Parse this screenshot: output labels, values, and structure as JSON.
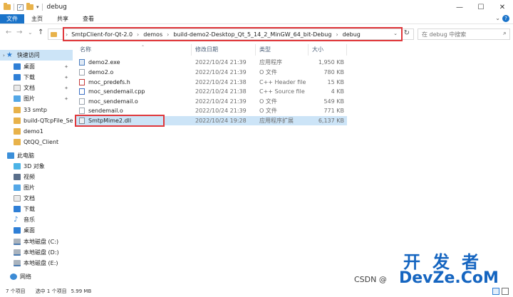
{
  "window": {
    "title": "debug",
    "minimize": "—",
    "maximize": "☐",
    "close": "✕"
  },
  "ribbon": {
    "tabs": [
      {
        "label": "文件"
      },
      {
        "label": "主页"
      },
      {
        "label": "共享"
      },
      {
        "label": "查看"
      }
    ],
    "expand": "⌄",
    "help": "?"
  },
  "nav": {
    "back": "←",
    "forward": "→",
    "recent": "⌄",
    "up": "↑"
  },
  "address": {
    "crumbs": [
      "SmtpClient-for-Qt-2.0",
      "demos",
      "build-demo2-Desktop_Qt_5_14_2_MinGW_64_bit-Debug",
      "debug"
    ],
    "separator": "›",
    "dropdown": "⌄",
    "refresh": "↻"
  },
  "search": {
    "placeholder": "在 debug 中搜索"
  },
  "sidebar": {
    "quick_access": "快速访问",
    "items": [
      {
        "label": "桌面",
        "pinned": true
      },
      {
        "label": "下载",
        "pinned": true
      },
      {
        "label": "文档",
        "pinned": true
      },
      {
        "label": "图片",
        "pinned": true
      },
      {
        "label": "33 smtp"
      },
      {
        "label": "build-QTcpFile_Se"
      },
      {
        "label": "demo1"
      },
      {
        "label": "QtQQ_Client"
      }
    ],
    "this_pc": "此电脑",
    "pc_items": [
      {
        "label": "3D 对象"
      },
      {
        "label": "视频"
      },
      {
        "label": "图片"
      },
      {
        "label": "文档"
      },
      {
        "label": "下载"
      },
      {
        "label": "音乐"
      },
      {
        "label": "桌面"
      },
      {
        "label": "本地磁盘 (C:)"
      },
      {
        "label": "本地磁盘 (D:)"
      },
      {
        "label": "本地磁盘 (E:)"
      }
    ],
    "network": "网络",
    "pin_glyph": "✦"
  },
  "columns": {
    "name": "名称",
    "modified": "修改日期",
    "type": "类型",
    "size": "大小",
    "sort_glyph": "⌃"
  },
  "files": [
    {
      "name": "demo2.exe",
      "modified": "2022/10/24 21:39",
      "type": "应用程序",
      "size": "1,950 KB",
      "icon": "exe"
    },
    {
      "name": "demo2.o",
      "modified": "2022/10/24 21:39",
      "type": "O 文件",
      "size": "780 KB",
      "icon": "o"
    },
    {
      "name": "moc_predefs.h",
      "modified": "2022/10/24 21:38",
      "type": "C++ Header file",
      "size": "15 KB",
      "icon": "h"
    },
    {
      "name": "moc_sendemail.cpp",
      "modified": "2022/10/24 21:38",
      "type": "C++ Source file",
      "size": "4 KB",
      "icon": "cpp"
    },
    {
      "name": "moc_sendemail.o",
      "modified": "2022/10/24 21:39",
      "type": "O 文件",
      "size": "549 KB",
      "icon": "o"
    },
    {
      "name": "sendemail.o",
      "modified": "2022/10/24 21:39",
      "type": "O 文件",
      "size": "771 KB",
      "icon": "o"
    },
    {
      "name": "SmtpMime2.dll",
      "modified": "2022/10/24 19:28",
      "type": "应用程序扩展",
      "size": "6,137 KB",
      "icon": "dll",
      "selected": true
    }
  ],
  "status": {
    "count": "7 个项目",
    "selected": "选中 1 个项目",
    "size": "5.99 MB"
  },
  "watermark": {
    "line1": "开发者",
    "line2": "DevZe.CoM",
    "csdn": "CSDN @"
  },
  "colors": {
    "accent": "#1a73c9",
    "highlight_box": "#e0373b",
    "selection": "#cce4f7"
  }
}
